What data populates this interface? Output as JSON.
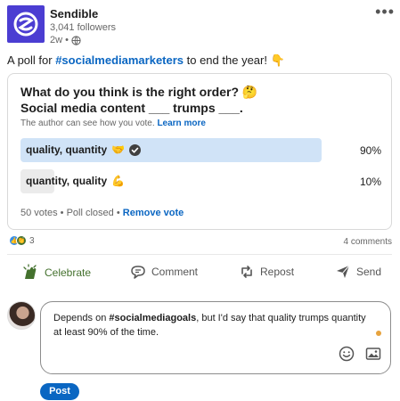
{
  "author": {
    "name": "Sendible",
    "followers": "3,041 followers",
    "time": "2w",
    "meta_separator": "•"
  },
  "post": {
    "text_before": "A poll for ",
    "hashtag": "#socialmediamarketers",
    "text_after": " to end the year! ",
    "emoji": "👇"
  },
  "poll": {
    "question_line1": "What do you think is the right order? 🤔",
    "question_line2": "Social media content ___ trumps ___.",
    "note": "The author can see how you vote.",
    "learn_more": "Learn more",
    "options": [
      {
        "label": "quality, quantity",
        "emoji": "🤝",
        "percent": "90%",
        "value": 0.9,
        "selected": true
      },
      {
        "label": "quantity, quality",
        "emoji": "💪",
        "percent": "10%",
        "value": 0.1,
        "selected": false
      }
    ],
    "votes": "50 votes",
    "status": "Poll closed",
    "separator": "•",
    "remove_vote": "Remove vote"
  },
  "social": {
    "reaction_count": "3",
    "comments": "4 comments"
  },
  "actions": {
    "celebrate": "Celebrate",
    "comment": "Comment",
    "repost": "Repost",
    "send": "Send"
  },
  "comment_box": {
    "text_before": "Depends on ",
    "hashtag": "#socialmediagoals",
    "text_after": ", but I'd say that quality trumps quantity at least 90% of the time."
  },
  "post_button": "Post",
  "colors": {
    "brand": "#4b3dd2",
    "link": "#0a66c2",
    "selected_bar": "#d0e3f7",
    "unselected_bar": "#ebebeb",
    "celebrate": "#44712e"
  }
}
